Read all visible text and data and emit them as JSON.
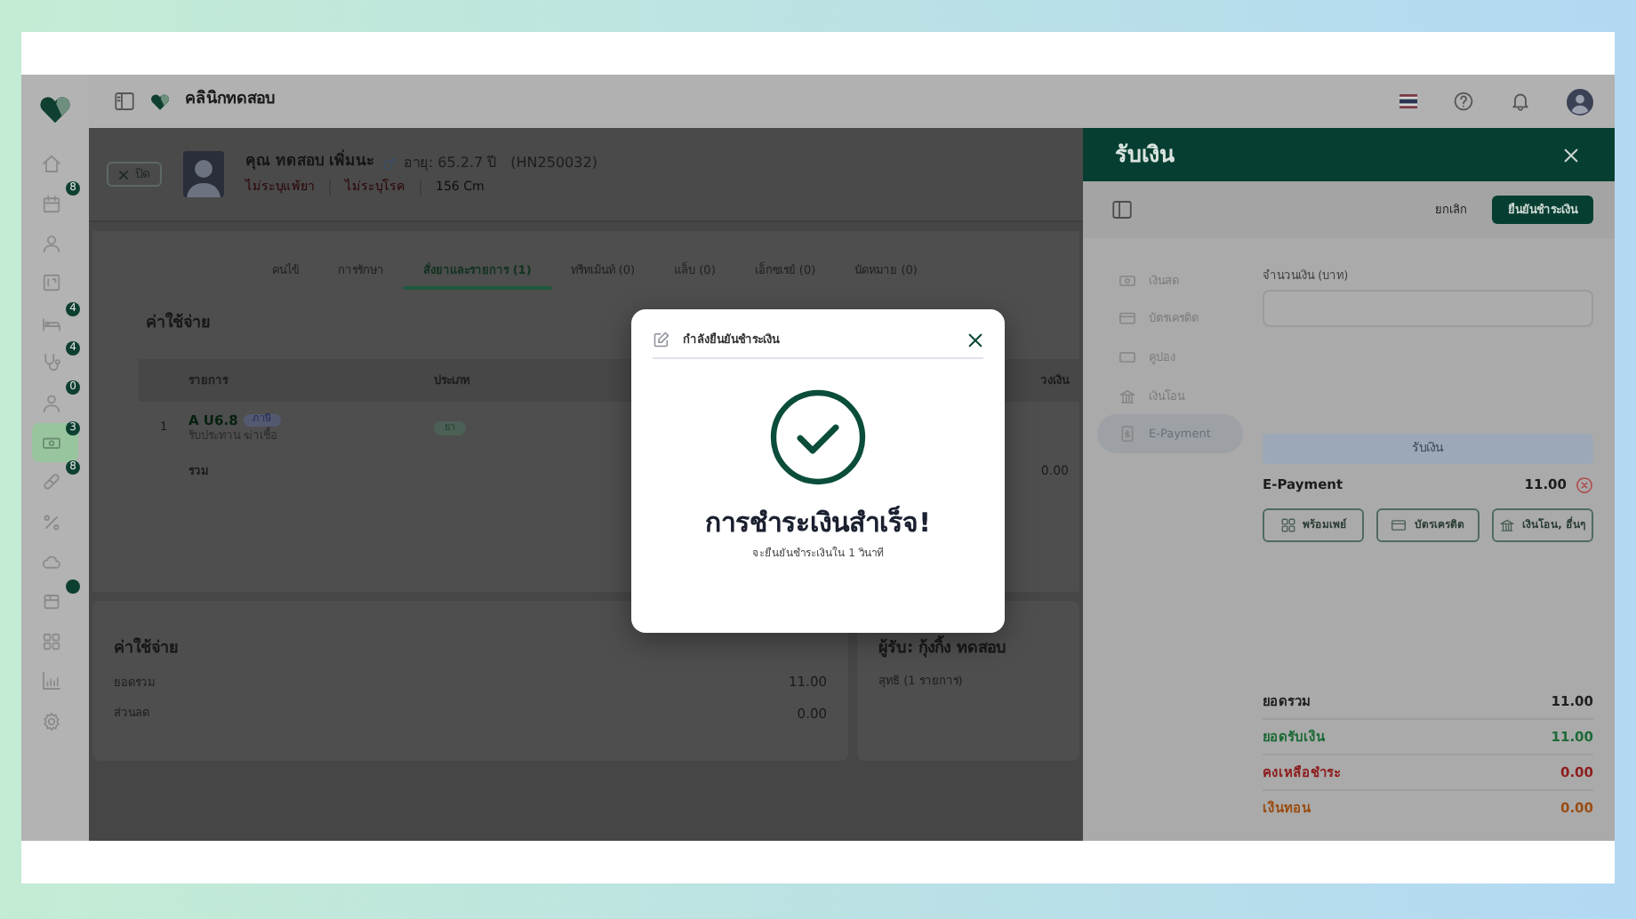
{
  "topbar": {
    "clinic_name": "คลินิกทดสอบ"
  },
  "sidebar": {
    "items": [
      {
        "selected": false,
        "notification_dot": false
      },
      {
        "badge": "8",
        "selected": false,
        "notification_dot": false
      },
      {
        "selected": false,
        "notification_dot": false
      },
      {
        "selected": false,
        "notification_dot": false
      },
      {
        "badge": "4",
        "selected": false,
        "notification_dot": false
      },
      {
        "badge": "4",
        "selected": false,
        "notification_dot": false
      },
      {
        "badge": "0",
        "selected": false,
        "notification_dot": false
      },
      {
        "badge": "3",
        "selected": true,
        "notification_dot": false
      },
      {
        "badge": "8",
        "selected": false,
        "notification_dot": false
      },
      {
        "selected": false,
        "notification_dot": false
      },
      {
        "selected": false,
        "notification_dot": false
      },
      {
        "selected": false,
        "notification_dot": true
      },
      {
        "selected": false,
        "notification_dot": false
      },
      {
        "selected": false,
        "notification_dot": false
      },
      {
        "selected": false,
        "notification_dot": false
      }
    ]
  },
  "patient": {
    "close_label": "ปิด",
    "name": "คุณ ทดสอบ เพิ่มนะ",
    "age": "อายุ: 65.2.7 ปี",
    "hn": "(HN250032)",
    "allergy": "ไม่ระบุแพ้ยา",
    "disease": "ไม่ระบุโรค",
    "height": "156 Cm"
  },
  "tabs": [
    {
      "label": "คนไข้",
      "selected": false
    },
    {
      "label": "การรักษา",
      "selected": false
    },
    {
      "label": "สั่งยาและรายการ (1)",
      "selected": true
    },
    {
      "label": "ทรีทเม้นท์ (0)",
      "selected": false
    },
    {
      "label": "แล็บ (0)",
      "selected": false
    },
    {
      "label": "เอ็กซเรย์ (0)",
      "selected": false
    },
    {
      "label": "นัดหมาย (0)",
      "selected": false
    }
  ],
  "expenses": {
    "title": "ค่าใช้จ่าย",
    "columns": [
      "รายการ",
      "ประเภท",
      "วงเงิน"
    ],
    "rows": [
      {
        "index": "1",
        "code": "A U6.8",
        "tag": "ภาษี",
        "note": "รับประทาน ฆ่าเชื้อ",
        "type": "ยา"
      }
    ],
    "total_label": "รวม",
    "total_value": "0.00"
  },
  "summary": {
    "title": "ค่าใช้จ่าย",
    "rows": [
      {
        "label": "ยอดรวม",
        "value": "11.00"
      },
      {
        "label": "ส่วนลด",
        "value": "0.00"
      }
    ]
  },
  "recipient": {
    "title": "ผู้รับ: กุ้งกิ้ง ทดสอบ",
    "line": "สุทธิ (1 รายการ)"
  },
  "drawer": {
    "title": "รับเงิน",
    "cancel": "ยกเลิก",
    "confirm": "ยืนยันชำระเงิน",
    "methods": [
      {
        "label": "เงินสด",
        "selected": false
      },
      {
        "label": "บัตรเครดิต",
        "selected": false
      },
      {
        "label": "คูปอง",
        "selected": false
      },
      {
        "label": "เงินโอน",
        "selected": false
      },
      {
        "label": "E-Payment",
        "selected": true
      }
    ],
    "amount_label": "จำนวนเงิน (บาท)",
    "receive_button": {
      "label": "รับเงิน",
      "disabled": true
    },
    "payment": {
      "label": "E-Payment",
      "amount": "11.00"
    },
    "options": [
      "พร้อมเพย์",
      "บัตรเครดิต",
      "เงินโอน, อื่นๆ"
    ],
    "totals": [
      {
        "label": "ยอดรวม",
        "value": "11.00",
        "color": "#1f1f1f"
      },
      {
        "label": "ยอดรับเงิน",
        "value": "11.00",
        "color": "#1d6a35"
      },
      {
        "label": "คงเหลือชำระ",
        "value": "0.00",
        "color": "#8e1d1d"
      },
      {
        "label": "เงินทอน",
        "value": "0.00",
        "color": "#9a4c12"
      }
    ]
  },
  "modal": {
    "title": "กำลังยืนยันชำระเงิน",
    "heading": "การชำระเงินสำเร็จ!",
    "message": "จะยืนยันชำระเงินใน 1 วินาที"
  }
}
